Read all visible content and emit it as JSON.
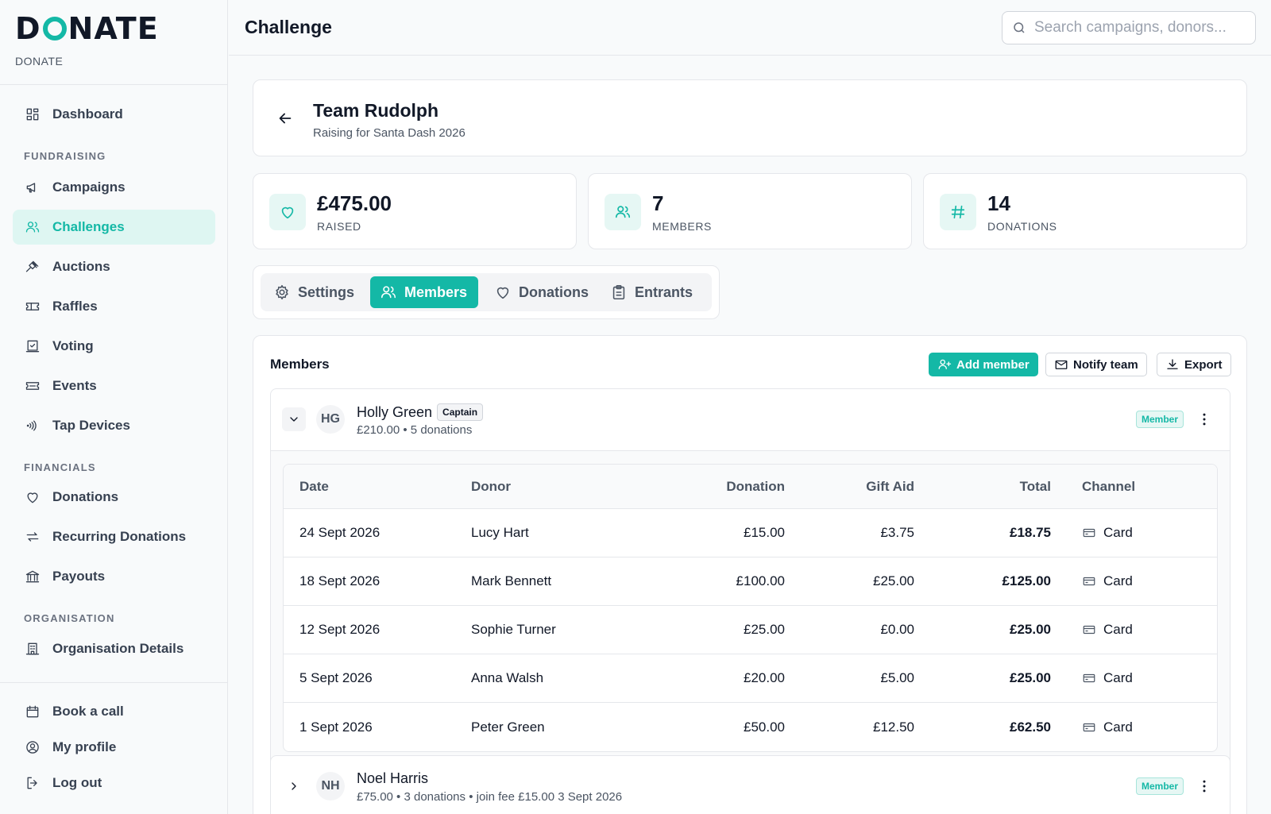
{
  "brand": {
    "logo": "DONATE",
    "subtitle": "DONATE"
  },
  "sidebar": {
    "items": [
      {
        "label": "Dashboard",
        "icon": "dashboard-icon"
      },
      {
        "label": "Campaigns",
        "icon": "megaphone-icon"
      },
      {
        "label": "Challenges",
        "icon": "users-icon",
        "active": true
      },
      {
        "label": "Auctions",
        "icon": "gavel-icon"
      },
      {
        "label": "Raffles",
        "icon": "ticket-icon"
      },
      {
        "label": "Voting",
        "icon": "ballot-icon"
      },
      {
        "label": "Events",
        "icon": "ticket-icon"
      },
      {
        "label": "Tap Devices",
        "icon": "contactless-icon"
      },
      {
        "label": "Donations",
        "icon": "heart-icon"
      },
      {
        "label": "Recurring Donations",
        "icon": "repeat-icon"
      },
      {
        "label": "Payouts",
        "icon": "bank-icon"
      },
      {
        "label": "Organisation Details",
        "icon": "building-icon"
      },
      {
        "label": "Book a call",
        "icon": "calendar-icon"
      },
      {
        "label": "My profile",
        "icon": "profile-icon"
      },
      {
        "label": "Log out",
        "icon": "logout-icon"
      }
    ],
    "sections": {
      "fundraising": "FUNDRAISING",
      "financials": "FINANCIALS",
      "organisation": "ORGANISATION"
    }
  },
  "topbar": {
    "title": "Challenge",
    "search_placeholder": "Search campaigns, donors..."
  },
  "team": {
    "name": "Team Rudolph",
    "subtitle": "Raising for Santa Dash 2026"
  },
  "stats": [
    {
      "value": "£475.00",
      "label": "RAISED",
      "icon": "heart-icon"
    },
    {
      "value": "7",
      "label": "MEMBERS",
      "icon": "users-icon"
    },
    {
      "value": "14",
      "label": "DONATIONS",
      "icon": "hash-icon"
    }
  ],
  "tabs": [
    {
      "label": "Settings",
      "icon": "gear-icon"
    },
    {
      "label": "Members",
      "icon": "users-icon",
      "active": true
    },
    {
      "label": "Donations",
      "icon": "heart-icon"
    },
    {
      "label": "Entrants",
      "icon": "clipboard-icon"
    }
  ],
  "members_section": {
    "title": "Members",
    "add_label": "Add member",
    "notify_label": "Notify team",
    "export_label": "Export"
  },
  "members": [
    {
      "initials": "HG",
      "name": "Holly Green",
      "tag": "Captain",
      "summary": "£210.00 • 5 donations",
      "role": "Member",
      "expanded": true
    },
    {
      "initials": "NH",
      "name": "Noel Harris",
      "summary": "£75.00 • 3 donations • join fee £15.00 3 Sept 2026",
      "role": "Member",
      "expanded": false
    }
  ],
  "donations_table": {
    "columns": [
      "Date",
      "Donor",
      "Donation",
      "Gift Aid",
      "Total",
      "Channel"
    ],
    "rows": [
      [
        "24 Sept 2026",
        "Lucy Hart",
        "£15.00",
        "£3.75",
        "£18.75",
        "Card"
      ],
      [
        "18 Sept 2026",
        "Mark Bennett",
        "£100.00",
        "£25.00",
        "£125.00",
        "Card"
      ],
      [
        "12 Sept 2026",
        "Sophie Turner",
        "£25.00",
        "£0.00",
        "£25.00",
        "Card"
      ],
      [
        "5 Sept 2026",
        "Anna Walsh",
        "£20.00",
        "£5.00",
        "£25.00",
        "Card"
      ],
      [
        "1 Sept 2026",
        "Peter Green",
        "£50.00",
        "£12.50",
        "£62.50",
        "Card"
      ]
    ]
  },
  "colors": {
    "accent": "#14b8a6",
    "accent_soft": "#def6f2",
    "text": "#111827",
    "muted": "#4b5563",
    "border": "#e5e7eb"
  }
}
